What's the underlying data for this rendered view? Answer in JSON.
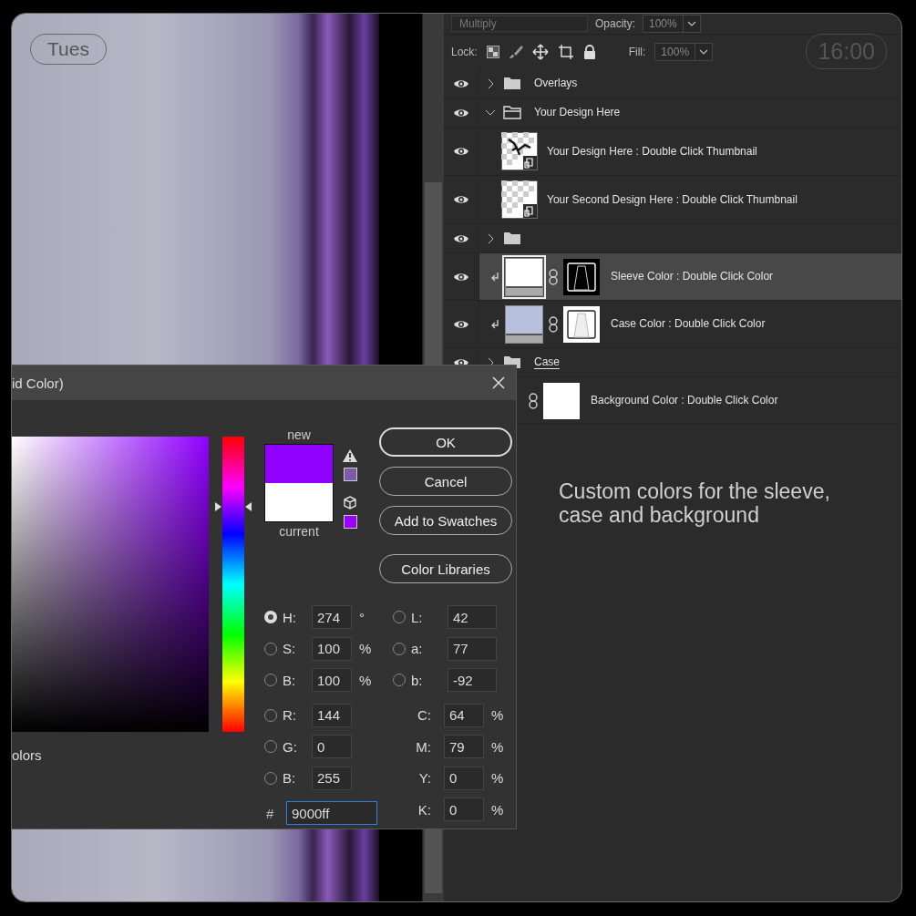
{
  "canvas": {
    "overlay_badge": "Tues"
  },
  "layers_panel": {
    "blend_mode": "Multiply",
    "opacity_label": "Opacity:",
    "opacity_value": "100%",
    "lock_label": "Lock:",
    "fill_label": "Fill:",
    "fill_value": "100%",
    "layers": [
      {
        "kind": "group",
        "name": "Overlays",
        "visible": true,
        "expanded": false,
        "selected": false,
        "underlined": false
      },
      {
        "kind": "group",
        "name": "Your Design Here",
        "visible": true,
        "expanded": true,
        "selected": false,
        "underlined": false,
        "children": [
          {
            "kind": "smart",
            "name": "Your Design Here : Double Click Thumbnail",
            "visible": true,
            "selected": false,
            "underlined": false
          },
          {
            "kind": "smart",
            "name": "Your Second Design Here : Double Click Thumbnail",
            "visible": true,
            "selected": false,
            "underlined": false
          }
        ]
      },
      {
        "kind": "group",
        "visible": true,
        "expanded": false,
        "selected": false,
        "underlined": false
      },
      {
        "kind": "fill",
        "name": "Sleeve Color : Double Click Color",
        "visible": true,
        "selected": true,
        "underlined": false,
        "clipped": true,
        "color": "#ffffff",
        "mask_dark": true
      },
      {
        "kind": "fill",
        "name": "Case Color : Double Click Color",
        "visible": true,
        "selected": false,
        "underlined": false,
        "clipped": true,
        "color": "#b7c0dc",
        "mask_dark": false
      },
      {
        "kind": "group",
        "name": "Case",
        "visible": true,
        "expanded": false,
        "selected": false,
        "underlined": true
      },
      {
        "kind": "fill",
        "name": "Background Color : Double Click Color",
        "selected": false,
        "underlined": false,
        "clipped": false,
        "mask_dark": false
      }
    ]
  },
  "time_badge": "16:00",
  "caption": "Custom colors for the sleeve, case and background",
  "color_picker": {
    "title": "id Color)",
    "new_label": "new",
    "current_label": "current",
    "web_colors_label": "olors",
    "buttons": [
      {
        "label": "OK",
        "default": true
      },
      {
        "label": "Cancel",
        "default": false
      },
      {
        "label": "Add to Swatches",
        "default": false
      },
      {
        "label": "Color Libraries",
        "default": false
      }
    ],
    "hsb_fields": [
      {
        "label": "H:",
        "value": "274",
        "unit": "°",
        "selected": true
      },
      {
        "label": "S:",
        "value": "100",
        "unit": "%",
        "selected": false
      },
      {
        "label": "B:",
        "value": "100",
        "unit": "%",
        "selected": false
      }
    ],
    "rgb_fields": [
      {
        "label": "R:",
        "value": "144",
        "selected": false
      },
      {
        "label": "G:",
        "value": "0",
        "selected": false
      },
      {
        "label": "B:",
        "value": "255",
        "selected": false
      }
    ],
    "lab_fields": [
      {
        "label": "L:",
        "value": "42",
        "selected": false
      },
      {
        "label": "a:",
        "value": "77",
        "selected": false
      },
      {
        "label": "b:",
        "value": "-92",
        "selected": false
      }
    ],
    "cmyk_fields": [
      {
        "label": "C:",
        "value": "64",
        "unit": "%"
      },
      {
        "label": "M:",
        "value": "79",
        "unit": "%"
      },
      {
        "label": "Y:",
        "value": "0",
        "unit": "%"
      },
      {
        "label": "K:",
        "value": "0",
        "unit": "%"
      }
    ],
    "hex": {
      "label": "#",
      "value": "9000ff",
      "focused": true
    }
  }
}
